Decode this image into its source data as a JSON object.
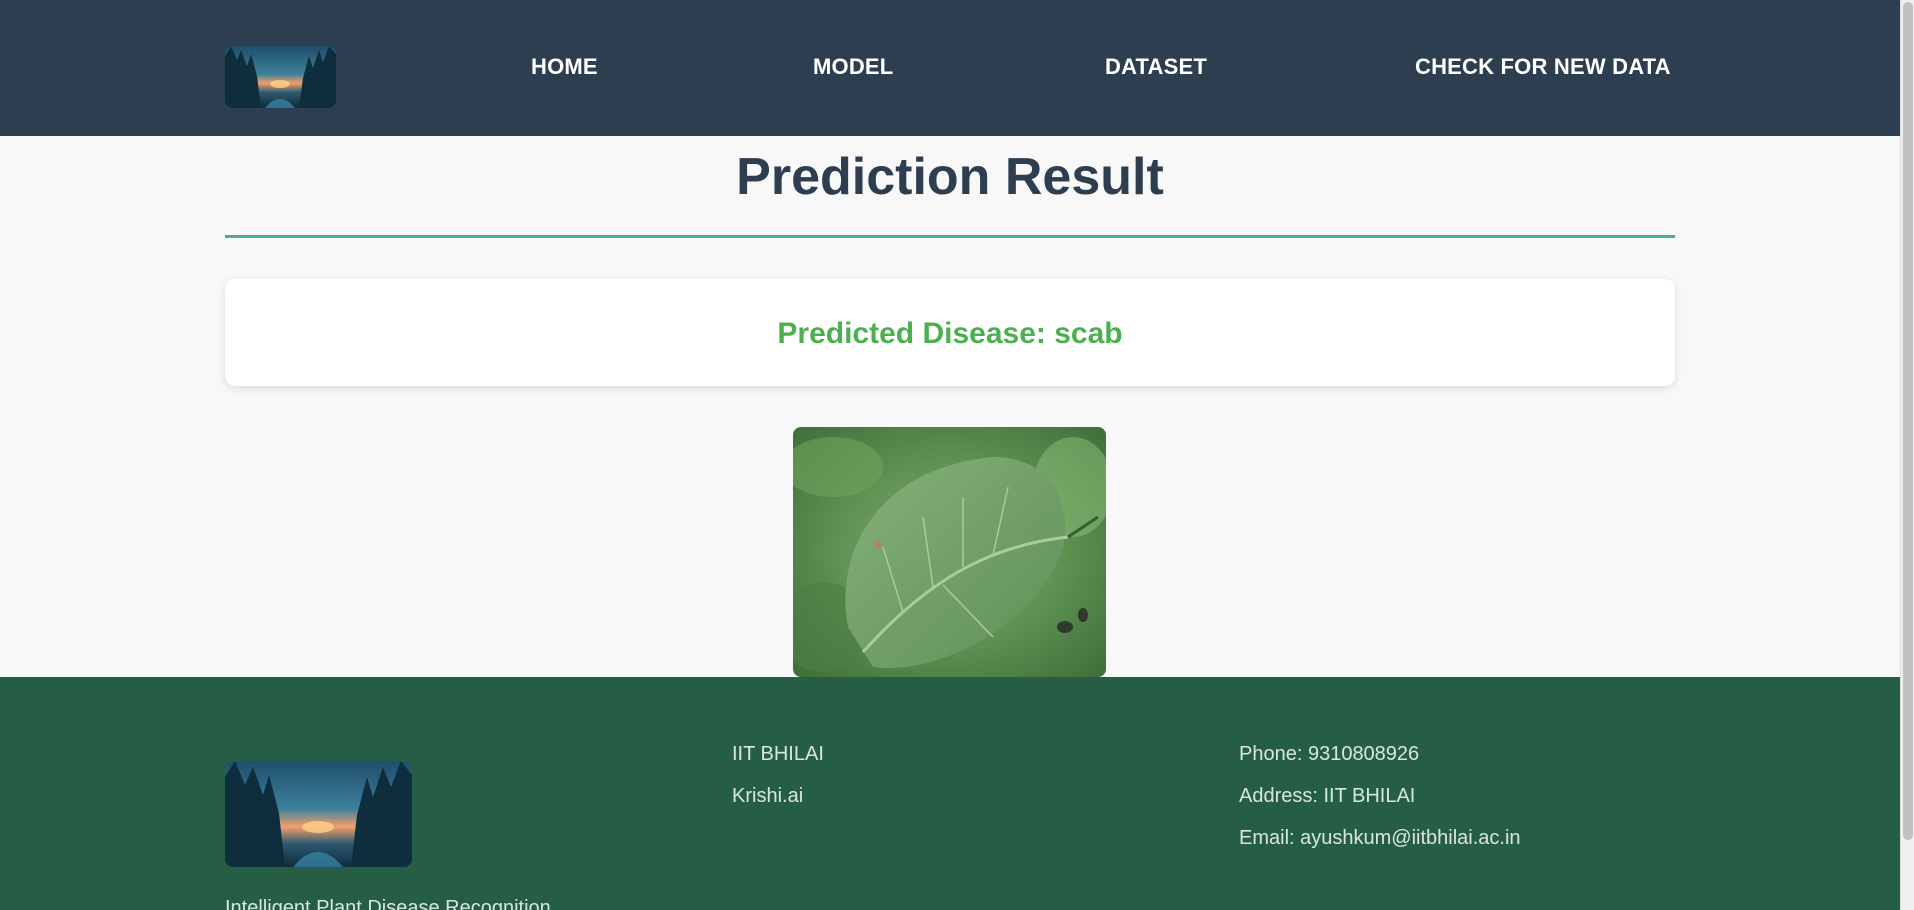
{
  "header": {
    "logo_icon": "forest-sunset-logo",
    "nav": [
      {
        "label": "HOME"
      },
      {
        "label": "MODEL"
      },
      {
        "label": "DATASET"
      },
      {
        "label": "CHECK FOR NEW DATA"
      }
    ]
  },
  "main": {
    "title": "Prediction Result",
    "result": "Predicted Disease: scab",
    "image_icon": "leaf-photo"
  },
  "footer": {
    "logo_icon": "forest-sunset-logo",
    "tagline": "Intelligent Plant Disease Recognition",
    "org_lines": [
      "IIT BHILAI",
      "Krishi.ai"
    ],
    "contact_lines": [
      "Phone: 9310808926",
      "Address: IIT BHILAI",
      "Email: ayushkum@iitbhilai.ac.in"
    ]
  },
  "colors": {
    "header_bg": "#2c3e50",
    "footer_bg": "#265e45",
    "accent_green": "#4caf50",
    "title_color": "#2c3e50"
  }
}
